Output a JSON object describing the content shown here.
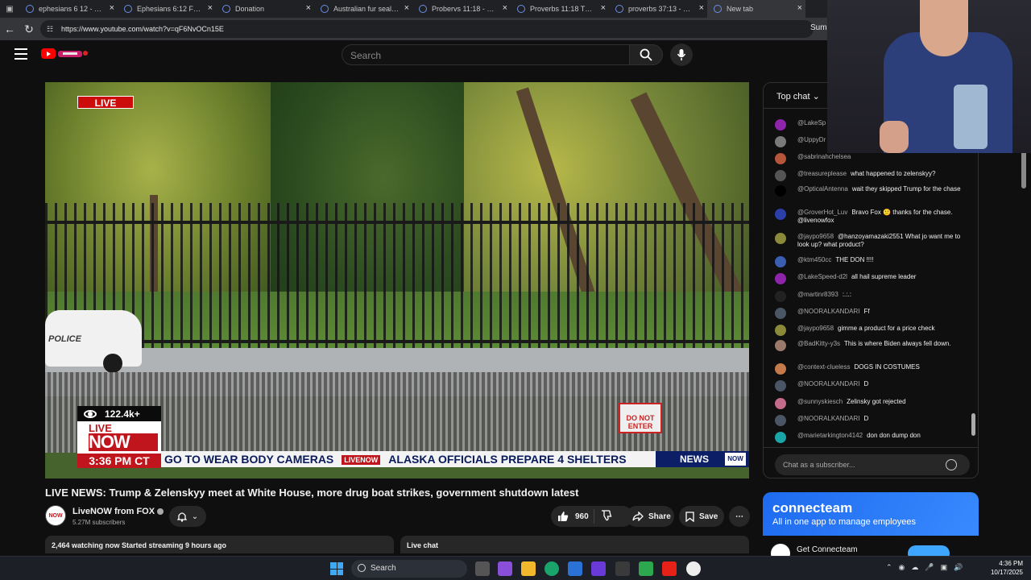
{
  "browser": {
    "tabs": [
      {
        "title": "ephesians 6 12 - Search"
      },
      {
        "title": "Ephesians 6:12 For our"
      },
      {
        "title": "Donation"
      },
      {
        "title": "Australian fur seal - Se"
      },
      {
        "title": "Probervs 11:18 - Search"
      },
      {
        "title": "Proverbs 11:18 The wi"
      },
      {
        "title": "proverbs 37:13 - Search"
      },
      {
        "title": "New tab"
      }
    ],
    "url": "https://www.youtube.com/watch?v=qF6NvOCn15E",
    "profile_text": "Summ"
  },
  "yt": {
    "search_placeholder": "Search"
  },
  "video": {
    "live_badge": "LIVE",
    "viewers": "122.4k+",
    "live_now_live": "LIVE",
    "live_now_now": "NOW",
    "time": "3:36 PM CT",
    "ticker_text_1": "GO TO WEAR BODY CAMERAS",
    "ticker_mini": "LIVENOW",
    "ticker_text_2": "ALASKA OFFICIALS PREPARE 4 SHELTERS",
    "ticker_news": "NEWS",
    "ticker_logo": "NOW",
    "police_text": "POLICE",
    "sign_text": "DO NOT ENTER",
    "title": "LIVE NEWS: Trump & Zelenskyy meet at White House, more drug boat strikes, government shutdown latest"
  },
  "channel": {
    "avatar_text": "NOW",
    "name": "LiveNOW from FOX",
    "subscribers": "5.27M subscribers"
  },
  "actions": {
    "likes": "960",
    "share": "Share",
    "save": "Save"
  },
  "status": {
    "watching": "2,464 watching now  Started streaming 9 hours ago",
    "live_chat": "Live chat"
  },
  "chat": {
    "header": "Top chat",
    "input_placeholder": "Chat as a subscriber...",
    "messages": [
      {
        "user": "@LakeSp",
        "text": "",
        "color": "#8e24aa"
      },
      {
        "user": "@UppyDr",
        "text": "",
        "color": "#7a7a7a"
      },
      {
        "user": "@sabrinahchelsea",
        "text": "",
        "color": "#b5563a"
      },
      {
        "user": "@treasureplease",
        "text": "what happened to zelenskyy?",
        "color": "#555555"
      },
      {
        "user": "@OpticalAntenna",
        "text": "wait they skipped Trump for the chase",
        "color": "#000000"
      },
      {
        "user": "@GroverHot_Luv",
        "text": "Bravo Fox 🙂 thanks for the chase. @livenowfox",
        "color": "#2b3fa8"
      },
      {
        "user": "@jaypo9658",
        "text": "@hanzoyamazaki2551 What jo want me to look up? what product?",
        "color": "#8a8a3a"
      },
      {
        "user": "@ktm450cc",
        "text": "THE DON !!!!",
        "color": "#3a5fb0"
      },
      {
        "user": "@LakeSpeed-d2l",
        "text": "all hail supreme leader",
        "color": "#8e24aa"
      },
      {
        "user": "@martinr8393",
        "text": ":.:.:",
        "color": "#222222"
      },
      {
        "user": "@NOORALKANDARI",
        "text": "Ff",
        "color": "#4a5566"
      },
      {
        "user": "@jaypo9658",
        "text": "gimme a product for a price check",
        "color": "#8a8a3a"
      },
      {
        "user": "@BadKitty-y3s",
        "text": "This is where Biden always fell down.",
        "color": "#9a7a6a"
      },
      {
        "user": "@context-clueless",
        "text": "DOGS IN COSTUMES",
        "color": "#c47a4a"
      },
      {
        "user": "@NOORALKANDARI",
        "text": "D",
        "color": "#4a5566"
      },
      {
        "user": "@sunnyskiesch",
        "text": "Zelinsky got rejected",
        "color": "#c46a8a"
      },
      {
        "user": "@NOORALKANDARI",
        "text": "D",
        "color": "#4a5566"
      },
      {
        "user": "@marietarkington4142",
        "text": "don don dump don",
        "color": "#1aa6a6"
      }
    ]
  },
  "ad": {
    "brand": "connecteam",
    "tagline": "All in one app to manage employees",
    "cta_name": "Get Connecteam"
  },
  "taskbar": {
    "search": "Search",
    "time": "4:36 PM",
    "date": "10/17/2025"
  }
}
